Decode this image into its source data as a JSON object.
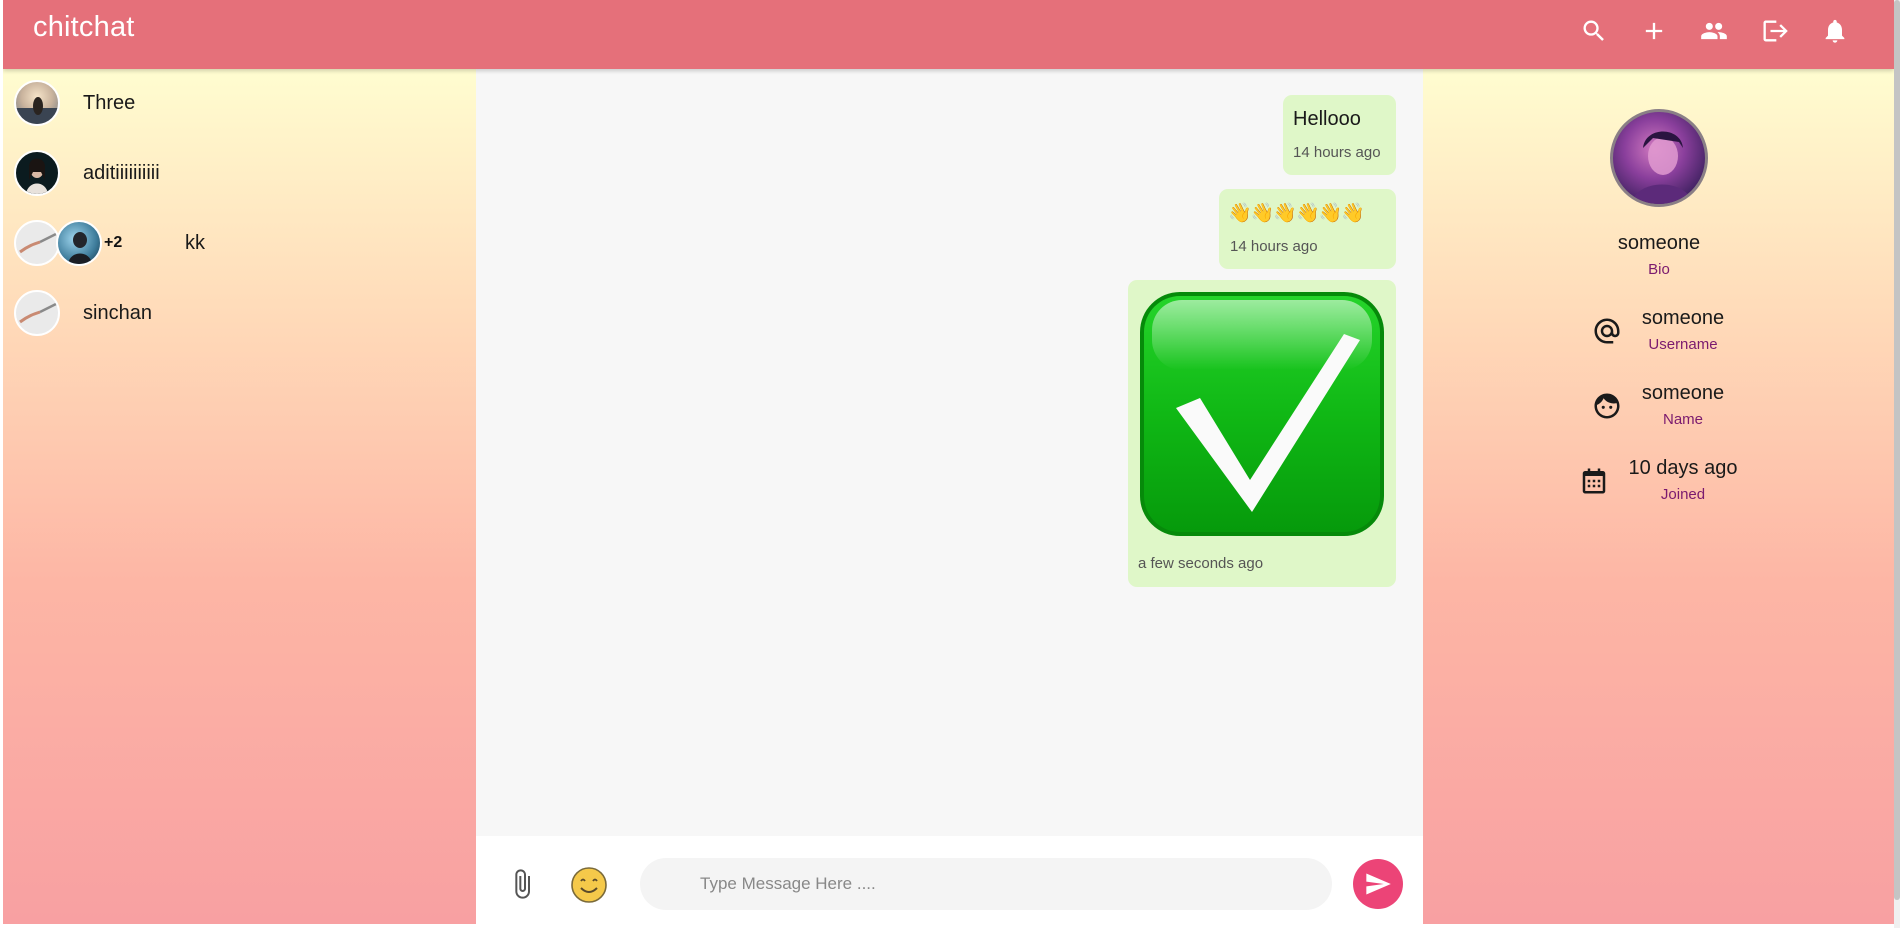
{
  "app": {
    "brand": "chitchat"
  },
  "header_icons": [
    "search-icon",
    "add-icon",
    "group-icon",
    "logout-icon",
    "notifications-icon"
  ],
  "chats": [
    {
      "name": "Three"
    },
    {
      "name": "aditiiiiiiiiii"
    },
    {
      "name": "kk",
      "extra_members": "+2"
    },
    {
      "name": "sinchan"
    }
  ],
  "messages": [
    {
      "text": "Hellooo",
      "time": "14 hours ago"
    },
    {
      "text": "👋👋👋👋👋👋",
      "time": "14 hours ago"
    },
    {
      "type": "image",
      "image": "green-checkmark",
      "time": "a few seconds ago"
    }
  ],
  "composer": {
    "placeholder": "Type Message Here ...."
  },
  "profile": {
    "name": "someone",
    "bio_label": "Bio",
    "username": "someone",
    "username_label": "Username",
    "full_name": "someone",
    "name_label": "Name",
    "joined": "10 days ago",
    "joined_label": "Joined"
  },
  "colors": {
    "appbar": "#e5707a",
    "bubble": "#dff7c8",
    "send_button": "#ec4477",
    "profile_label": "#7b1a6e"
  }
}
